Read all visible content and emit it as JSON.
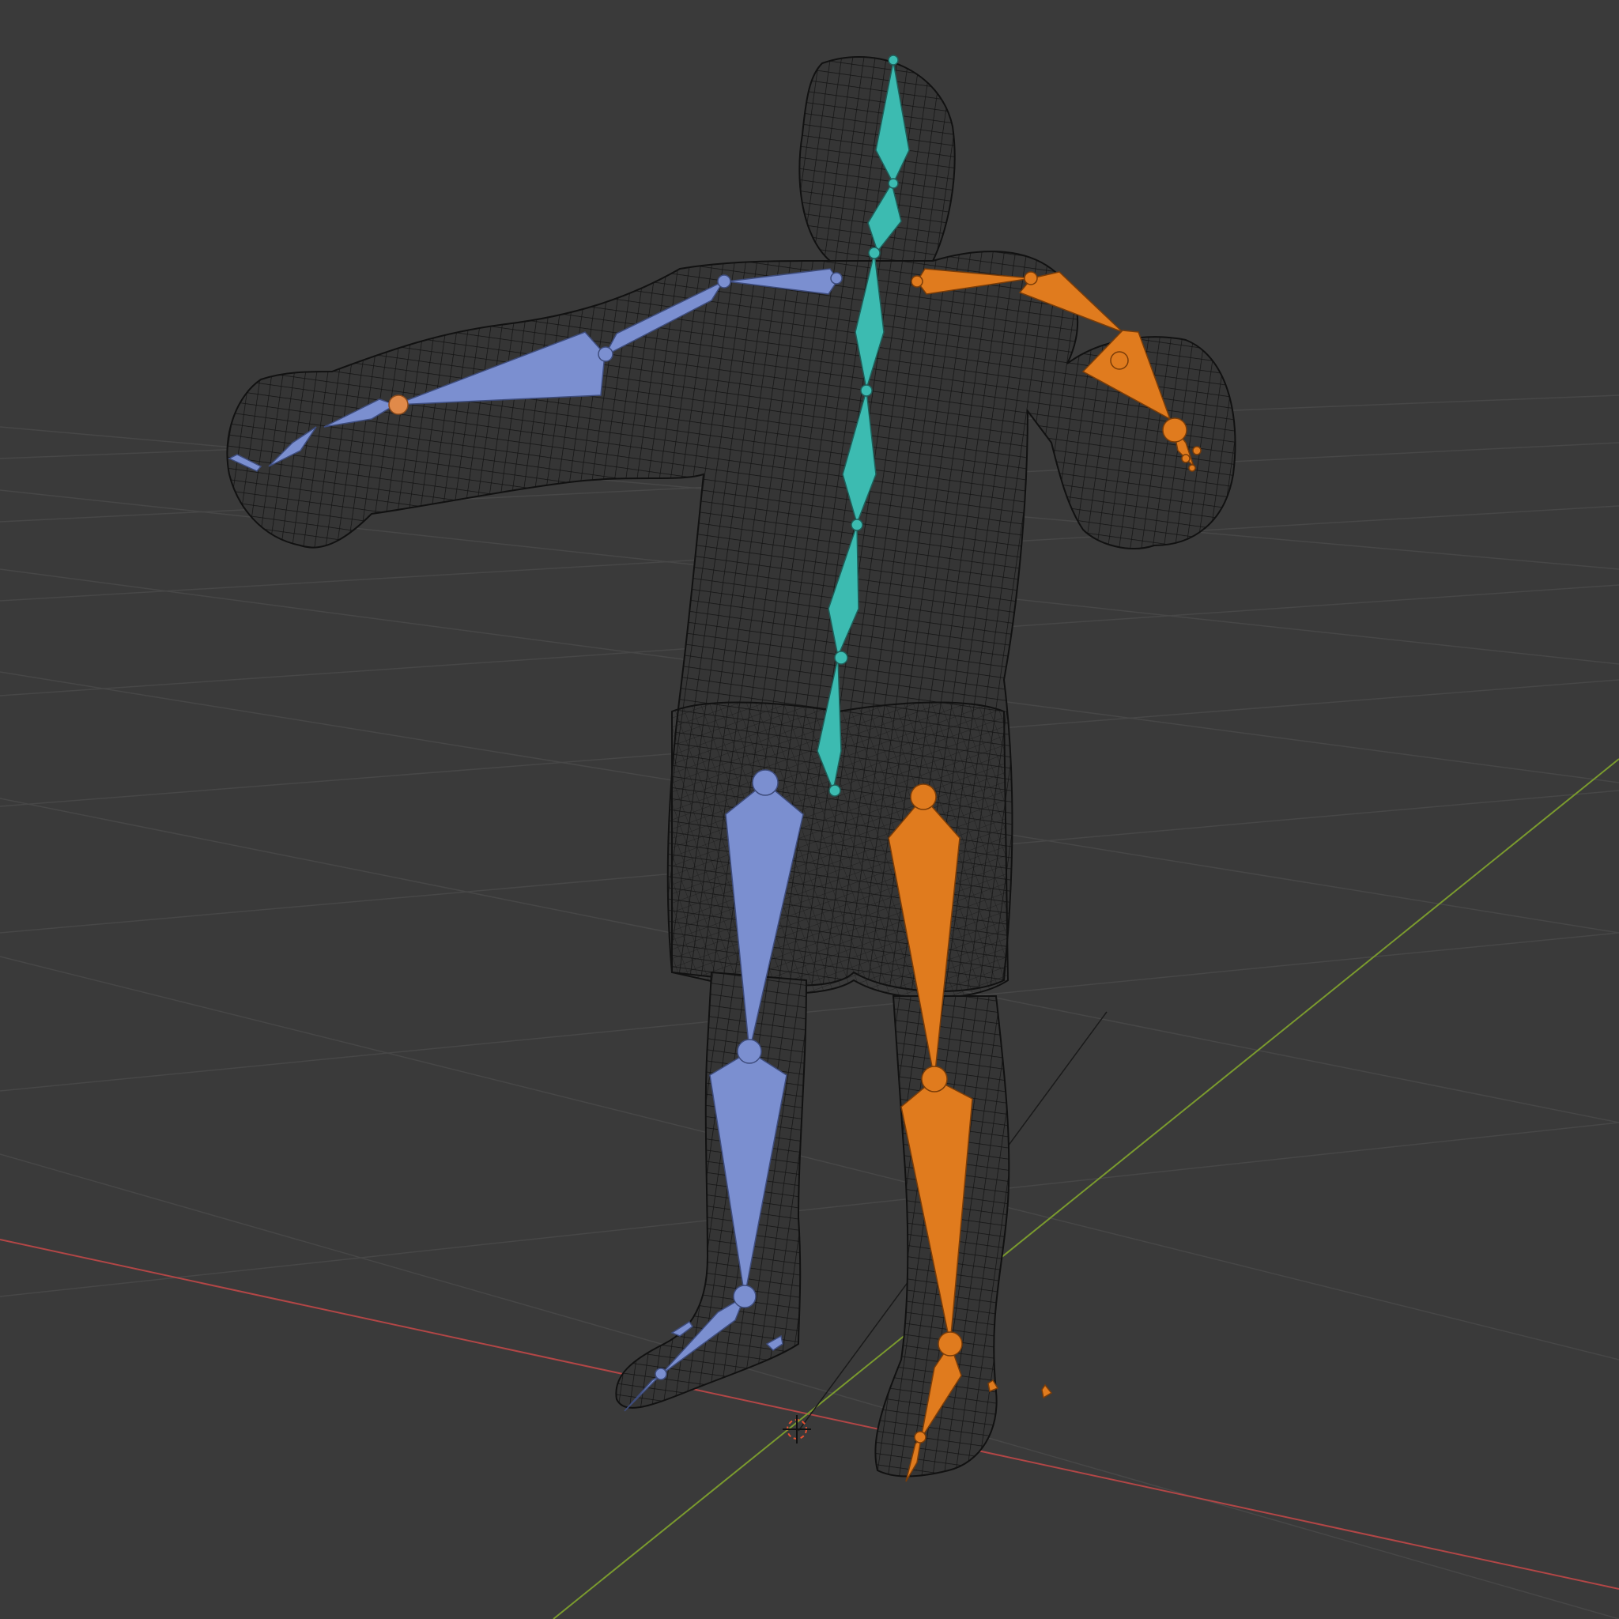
{
  "viewport": {
    "background": "#3a3a3a",
    "grid_color": "#474747",
    "x_axis_color": "#b24646",
    "y_axis_color": "#7a9a2e",
    "mesh_color": "#111111",
    "spine_color": "#3cbbb1",
    "left_side_color": "#7b8fd0",
    "right_side_color": "#e07b1e"
  },
  "scene_objects": [
    {
      "name": "character-mesh",
      "display": "wireframe"
    },
    {
      "name": "armature",
      "display": "octahedral"
    },
    {
      "name": "3d-cursor",
      "icon": "crosshair-icon"
    }
  ]
}
